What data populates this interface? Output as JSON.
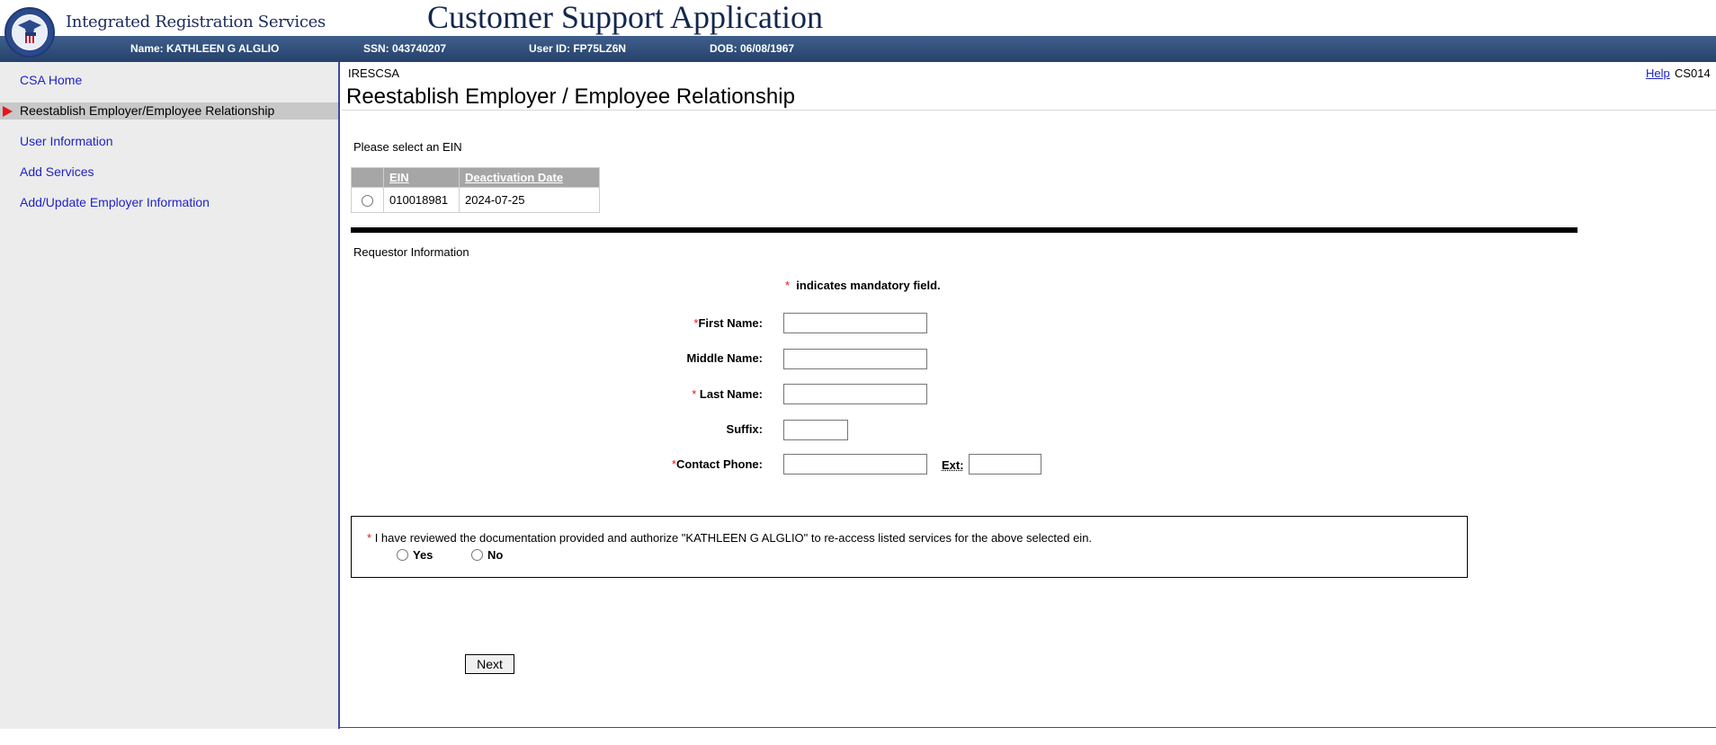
{
  "header": {
    "brand": "Integrated Registration Services",
    "app_title": "Customer Support Application",
    "info": {
      "name": "Name: KATHLEEN G ALGLIO",
      "ssn": "SSN: 043740207",
      "user_id": "User ID: FP75LZ6N",
      "dob": "DOB: 06/08/1967"
    }
  },
  "sidebar": {
    "items": [
      {
        "label": "CSA Home",
        "active": false
      },
      {
        "label": "Reestablish Employer/Employee Relationship",
        "active": true
      },
      {
        "label": "User Information",
        "active": false
      },
      {
        "label": "Add Services",
        "active": false
      },
      {
        "label": "Add/Update Employer Information",
        "active": false
      }
    ]
  },
  "main": {
    "page_code": "IRESCSA",
    "title": "Reestablish Employer / Employee Relationship",
    "help_label": "Help",
    "screen_id": "CS014",
    "select_prompt": "Please select an EIN",
    "ein_table": {
      "headers": [
        "",
        "EIN",
        "Deactivation Date"
      ],
      "rows": [
        {
          "ein": "010018981",
          "deactivation_date": "2024-07-25",
          "selected": false
        }
      ]
    },
    "requestor_heading": "Requestor Information",
    "mandatory_star": "*",
    "mandatory_note": "indicates mandatory field.",
    "fields": {
      "first_name": {
        "label": "First Name:",
        "required": true,
        "value": ""
      },
      "middle_name": {
        "label": "Middle Name:",
        "required": false,
        "value": ""
      },
      "last_name": {
        "label": "Last Name:",
        "required": true,
        "value": ""
      },
      "suffix": {
        "label": "Suffix:",
        "required": false,
        "value": ""
      },
      "contact_phone": {
        "label": "Contact Phone:",
        "required": true,
        "value": ""
      },
      "ext": {
        "label": "Ext:",
        "value": ""
      }
    },
    "authorization": {
      "text": "I have reviewed the documentation provided and authorize \"KATHLEEN G ALGLIO\" to re-access listed services for the above selected ein.",
      "yes_label": "Yes",
      "no_label": "No"
    },
    "next_label": "Next"
  },
  "colors": {
    "info_bar": "#2f4f7a",
    "link": "#1f22c8",
    "required_star": "#e8141c",
    "active_nav_bg": "#c8c8c8",
    "table_header_bg": "#a6a6a6"
  }
}
